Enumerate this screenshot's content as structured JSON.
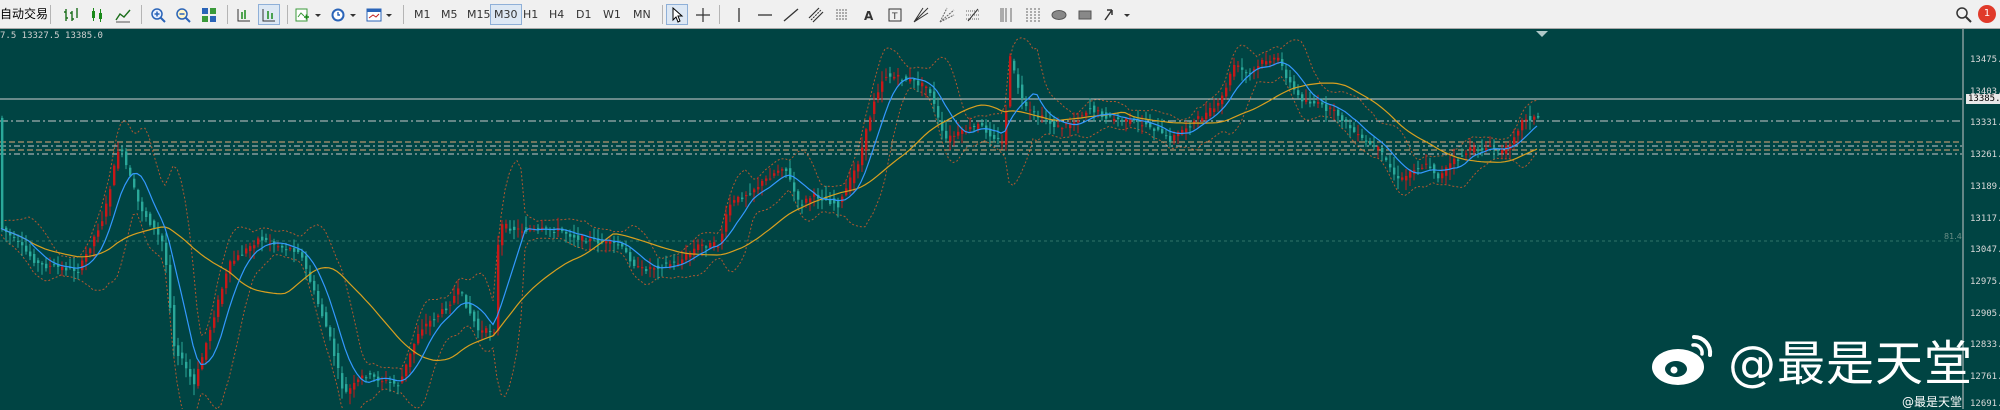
{
  "toolbar": {
    "auto_trading_label": "自动交易",
    "timeframes": [
      "M1",
      "M5",
      "M15",
      "M30",
      "H1",
      "H4",
      "D1",
      "W1",
      "MN"
    ],
    "active_timeframe": "M30",
    "notification_count": "1"
  },
  "chart": {
    "ohlc_info": "7.5 13327.5 13385.0",
    "level_label": "81.4",
    "current_price": "13385.0",
    "price_labels": [
      "13475.0",
      "13403.0",
      "13331.0",
      "13261.0",
      "13189.0",
      "13117.0",
      "13047.0",
      "12975.0",
      "12905.0",
      "12833.0",
      "12761.0",
      "12691.0"
    ],
    "colors": {
      "background": "#004443",
      "bull": "#c81818",
      "bear": "#2aa89a",
      "ma_fast": "#3399ff",
      "ma_slow": "#d8a020",
      "bands": "#b05830"
    }
  },
  "watermark": {
    "main_text": "@最是天堂",
    "sub_text": "@最是天堂"
  }
}
